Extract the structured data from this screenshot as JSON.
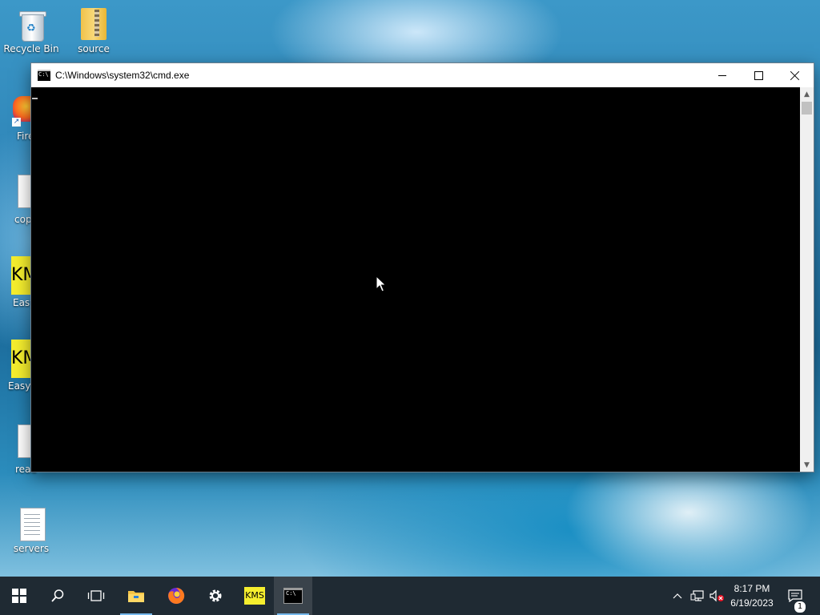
{
  "desktop": {
    "icons": [
      {
        "label": "Recycle Bin",
        "icon": "recycle-bin-icon"
      },
      {
        "label": "source",
        "icon": "zip-folder-icon"
      },
      {
        "label": "servers",
        "icon": "text-document-icon"
      }
    ],
    "edge_icons": [
      {
        "label": "Fire",
        "icon": "firefox-shortcut-icon"
      },
      {
        "label": "cop",
        "icon": "text-document-icon"
      },
      {
        "label": "Easy",
        "icon": "kms-app-icon",
        "glyph": "KM"
      },
      {
        "label": "Easyk",
        "icon": "kms-app-icon",
        "glyph": "KM"
      },
      {
        "label": "read",
        "icon": "text-document-icon"
      }
    ]
  },
  "window": {
    "title": "C:\\Windows\\system32\\cmd.exe",
    "icon_glyph": "C:\\",
    "console_text": ""
  },
  "taskbar": {
    "apps": [
      {
        "name": "start",
        "icon": "windows-logo-icon"
      },
      {
        "name": "search",
        "icon": "search-icon"
      },
      {
        "name": "task-view",
        "icon": "task-view-icon"
      },
      {
        "name": "file-explorer",
        "icon": "folder-icon"
      },
      {
        "name": "firefox",
        "icon": "firefox-icon"
      },
      {
        "name": "settings",
        "icon": "gear-icon"
      },
      {
        "name": "kms",
        "icon": "kms-app-icon",
        "glyph": "KMS"
      },
      {
        "name": "cmd",
        "icon": "cmd-icon"
      }
    ],
    "clock": {
      "time": "8:17 PM",
      "date": "6/19/2023"
    },
    "notifications_count": "1"
  },
  "colors": {
    "taskbar_bg": "#1f2a33",
    "console_bg": "#000000",
    "titlebar_bg": "#ffffff",
    "kms_yellow": "#f5ee2e",
    "running_indicator": "#76b9ed"
  }
}
